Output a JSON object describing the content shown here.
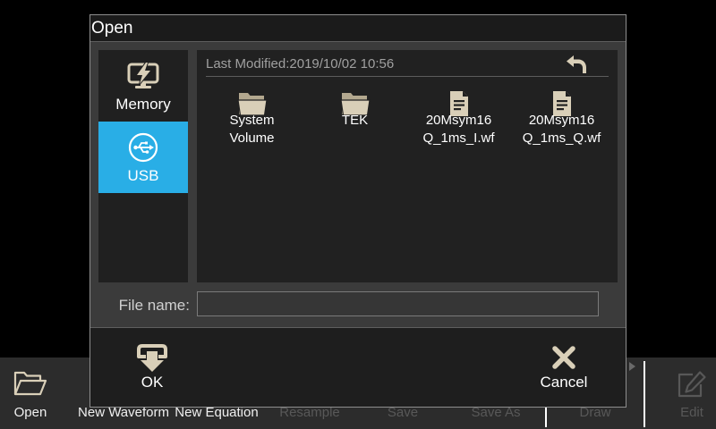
{
  "colors": {
    "accent": "#29aee6",
    "icon": "#d9cfb8",
    "disabled": "#585858"
  },
  "toolbar": {
    "overflow_icon": "more-arrow-icon",
    "items": [
      {
        "label": "Open",
        "icon": "folder-open-icon",
        "enabled": true
      },
      {
        "label": "New Waveform",
        "enabled": true
      },
      {
        "label": "New Equation",
        "enabled": true
      },
      {
        "label": "Resample",
        "enabled": false
      },
      {
        "label": "Save",
        "enabled": false
      },
      {
        "label": "Save As",
        "enabled": false
      },
      {
        "label": "Draw",
        "enabled": false
      },
      {
        "label": "Edit",
        "icon": "edit-icon",
        "enabled": false
      }
    ]
  },
  "dialog": {
    "title": "Open",
    "locations": [
      {
        "label": "Memory",
        "icon": "memory-icon",
        "selected": false
      },
      {
        "label": "USB",
        "icon": "usb-icon",
        "selected": true
      }
    ],
    "browser": {
      "last_modified_label": "Last Modified:",
      "last_modified_value": "2019/10/02 10:56",
      "back_icon": "back-arrow-icon",
      "files": [
        {
          "lines": [
            "System",
            "Volume"
          ],
          "icon": "folder-icon"
        },
        {
          "lines": [
            "TEK"
          ],
          "icon": "folder-icon"
        },
        {
          "lines": [
            "20Msym16",
            "Q_1ms_I.wf"
          ],
          "icon": "document-icon"
        },
        {
          "lines": [
            "20Msym16",
            "Q_1ms_Q.wf"
          ],
          "icon": "document-icon"
        }
      ]
    },
    "file_name": {
      "label": "File name:",
      "value": ""
    },
    "buttons": {
      "ok": {
        "label": "OK",
        "icon": "load-icon"
      },
      "cancel": {
        "label": "Cancel",
        "icon": "close-icon"
      }
    }
  }
}
